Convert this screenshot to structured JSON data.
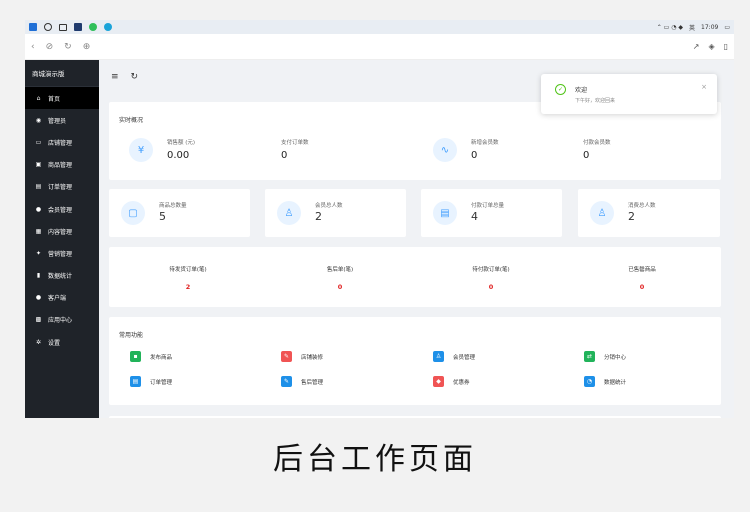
{
  "taskbar": {
    "time": "17:09",
    "lang": "英"
  },
  "browser": {
    "icons": [
      "back-icon",
      "link-icon",
      "refresh-icon",
      "globe-icon"
    ]
  },
  "sidebar": {
    "brand": "商城演示版",
    "items": [
      {
        "label": "首页",
        "icon": "home-icon",
        "glyph": "⌂"
      },
      {
        "label": "管理员",
        "icon": "admin-icon",
        "glyph": "◉"
      },
      {
        "label": "店铺管理",
        "icon": "shop-icon",
        "glyph": "▭"
      },
      {
        "label": "商品管理",
        "icon": "goods-icon",
        "glyph": "▣"
      },
      {
        "label": "订单管理",
        "icon": "order-icon",
        "glyph": "▤"
      },
      {
        "label": "会员管理",
        "icon": "member-icon",
        "glyph": "●"
      },
      {
        "label": "内容管理",
        "icon": "content-icon",
        "glyph": "▦"
      },
      {
        "label": "营销管理",
        "icon": "marketing-icon",
        "glyph": "✦"
      },
      {
        "label": "数据统计",
        "icon": "stats-icon",
        "glyph": "▮"
      },
      {
        "label": "客户端",
        "icon": "client-icon",
        "glyph": "●"
      },
      {
        "label": "应用中心",
        "icon": "apps-icon",
        "glyph": "▩"
      },
      {
        "label": "设置",
        "icon": "settings-icon",
        "glyph": "✲"
      }
    ]
  },
  "overview": {
    "title": "实时概况",
    "items": [
      {
        "label": "销售额 (元)",
        "value": "0.00",
        "glyph": "¥"
      },
      {
        "label": "支付订单数",
        "value": "0"
      },
      {
        "label": "新增会员数",
        "value": "0",
        "glyph": "∿"
      },
      {
        "label": "付款会员数",
        "value": "0"
      }
    ]
  },
  "minis": [
    {
      "label": "商品总数量",
      "value": "5",
      "glyph": "▢"
    },
    {
      "label": "会员总人数",
      "value": "2",
      "glyph": "♙"
    },
    {
      "label": "付款订单总量",
      "value": "4",
      "glyph": "▤"
    },
    {
      "label": "消费总人数",
      "value": "2",
      "glyph": "♙"
    }
  ],
  "pending": [
    {
      "label": "待发货订单(笔)",
      "value": "2"
    },
    {
      "label": "售后单(笔)",
      "value": "0"
    },
    {
      "label": "待付款订单(笔)",
      "value": "0"
    },
    {
      "label": "已售罄商品",
      "value": "0"
    }
  ],
  "functions": {
    "title": "常用功能",
    "items": [
      {
        "label": "发布商品",
        "color": "#21b35a",
        "glyph": "▪"
      },
      {
        "label": "店铺装修",
        "color": "#f05454",
        "glyph": "✎"
      },
      {
        "label": "会员管理",
        "color": "#1e90e8",
        "glyph": "♙"
      },
      {
        "label": "分销中心",
        "color": "#21b35a",
        "glyph": "⇄"
      },
      {
        "label": "订单管理",
        "color": "#1e90e8",
        "glyph": "▤"
      },
      {
        "label": "售后管理",
        "color": "#1e90e8",
        "glyph": "✎"
      },
      {
        "label": "优惠券",
        "color": "#f05454",
        "glyph": "◆"
      },
      {
        "label": "数据统计",
        "color": "#1e90e8",
        "glyph": "◔"
      }
    ]
  },
  "toast": {
    "title": "欢迎",
    "message": "下午好，欢迎回来",
    "check": "✓",
    "close": "×"
  },
  "caption": "后台工作页面"
}
